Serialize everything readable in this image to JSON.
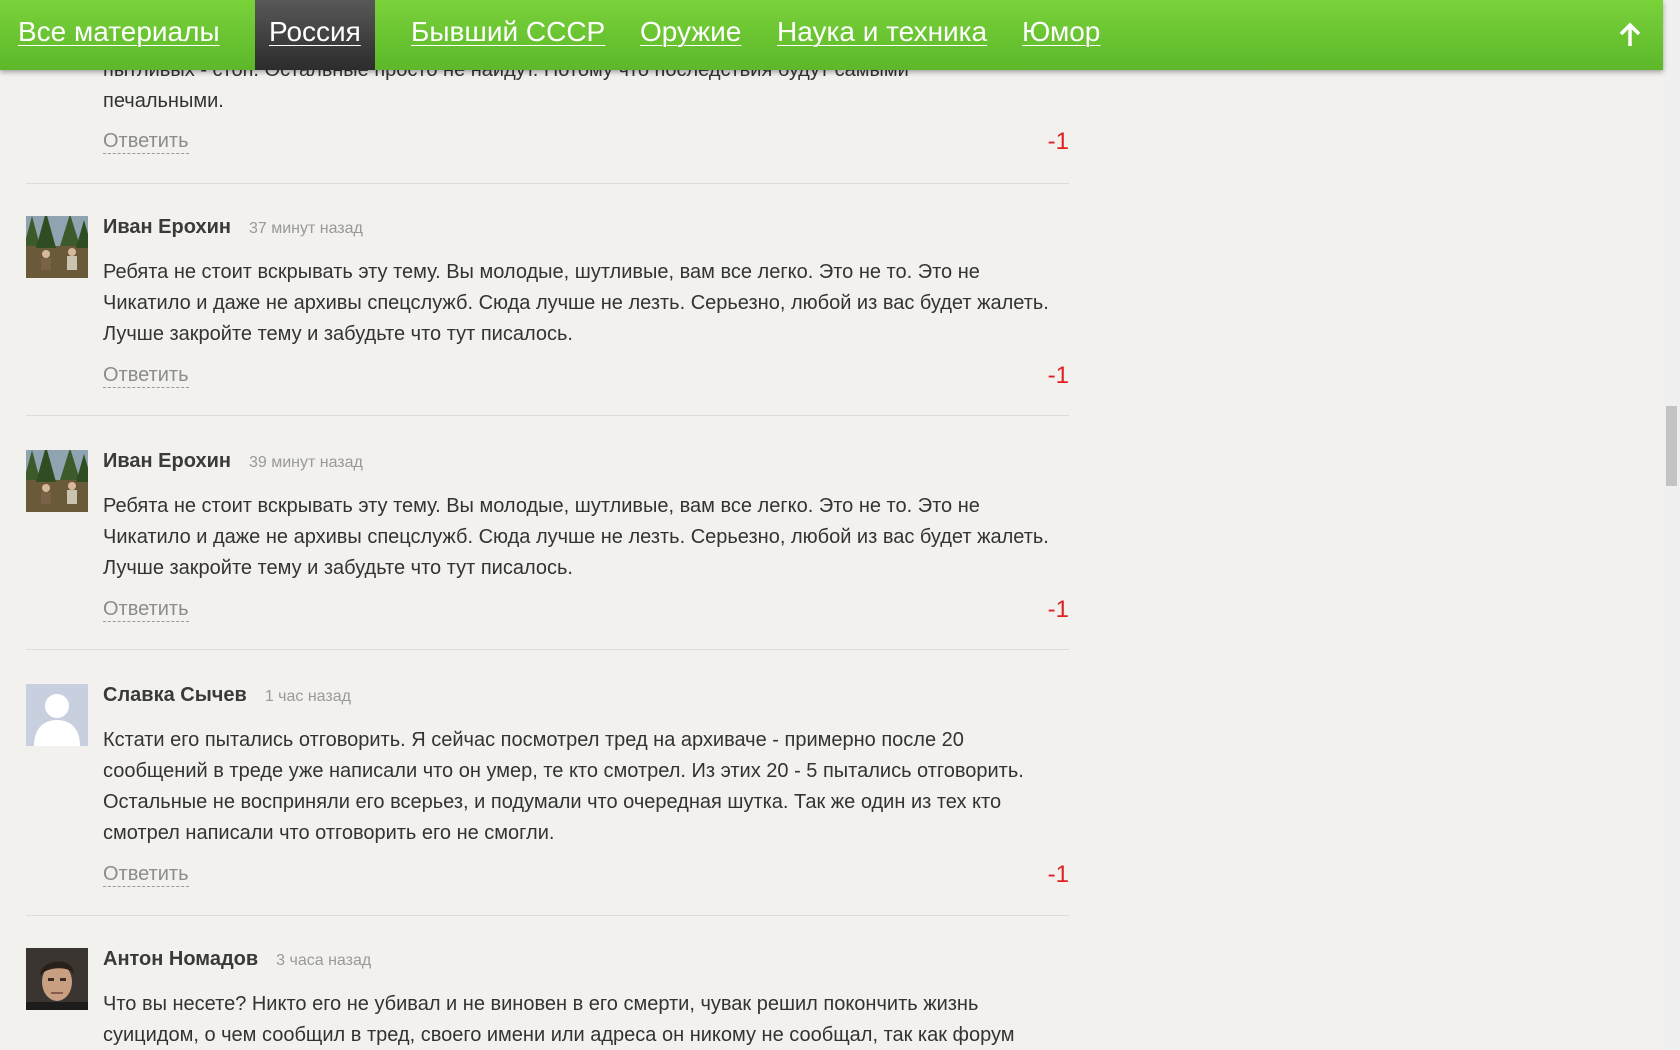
{
  "nav": {
    "items": [
      {
        "label": "Все материалы"
      },
      {
        "label": "Россия"
      },
      {
        "label": "Бывший СССР"
      },
      {
        "label": "Оружие"
      },
      {
        "label": "Наука и техника"
      },
      {
        "label": "Юмор"
      }
    ],
    "active_index": 1,
    "up_icon": "arrow-up-icon"
  },
  "comments": [
    {
      "text_line1": "пытливых - стоп. Остальные просто не найдут. Потому что последствия будут самыми",
      "text_line2": "печальными.",
      "reply_label": "Ответить",
      "rating": "-1"
    },
    {
      "author": "Иван Ерохин",
      "time": "37 минут назад",
      "text": "Ребята не стоит вскрывать эту тему. Вы молодые, шутливые, вам все легко. Это не то. Это не Чикатило и даже не архивы спецслужб. Сюда лучше не лезть. Серьезно, любой из вас будет жалеть. Лучше закройте тему и забудьте что тут писалось.",
      "reply_label": "Ответить",
      "rating": "-1",
      "avatar_icon": "forest-photo-avatar"
    },
    {
      "author": "Иван Ерохин",
      "time": "39 минут назад",
      "text": "Ребята не стоит вскрывать эту тему. Вы молодые, шутливые, вам все легко. Это не то. Это не Чикатило и даже не архивы спецслужб. Сюда лучше не лезть. Серьезно, любой из вас будет жалеть. Лучше закройте тему и забудьте что тут писалось.",
      "reply_label": "Ответить",
      "rating": "-1",
      "avatar_icon": "forest-photo-avatar"
    },
    {
      "author": "Славка Сычев",
      "time": "1 час назад",
      "text": "Кстати его пытались отговорить. Я сейчас посмотрел тред на архиваче - примерно после 20 сообщений в треде уже написали что он умер, те кто смотрел. Из этих 20 - 5 пытались отговорить. Остальные не восприняли его всерьез, и подумали что очередная шутка. Так же один из тех кто смотрел написали что отговорить его не смогли.",
      "reply_label": "Ответить",
      "rating": "-1",
      "avatar_icon": "default-user-avatar"
    },
    {
      "author": "Антон Номадов",
      "time": "3 часа назад",
      "text_line1": "Что вы несете? Никто его не убивал и не виновен в его смерти, чувак решил покончить жизнь",
      "text_line2": "суицидом, о чем сообщил в тред, своего имени или адреса он никому не сообщал, так как форум",
      "avatar_icon": "portrait-photo-avatar"
    }
  ],
  "colors": {
    "nav_green": "#6cc631",
    "rating_red": "#e02020",
    "background": "#f2f1ee"
  }
}
